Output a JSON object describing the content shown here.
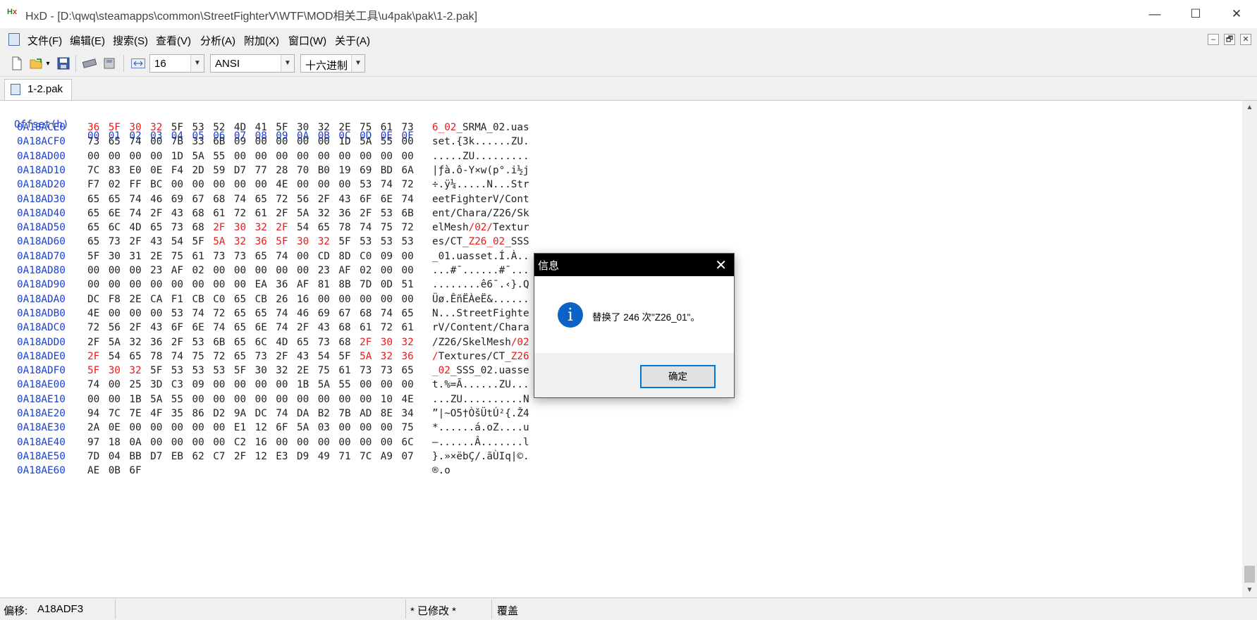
{
  "window": {
    "title": "HxD - [D:\\qwq\\steamapps\\common\\StreetFighterV\\WTF\\MOD相关工具\\u4pak\\pak\\1-2.pak]",
    "app_icon": "HxD",
    "minimize": "—",
    "maximize": "☐",
    "close": "✕"
  },
  "menu": {
    "items": [
      "文件(F)",
      "编辑(E)",
      "搜索(S)",
      "查看(V)",
      "分析(A)",
      "附加(X)",
      "窗口(W)",
      "关于(A)"
    ],
    "mdi": [
      "–",
      "🗗",
      "✕"
    ]
  },
  "toolbar": {
    "icons": [
      "new-file-icon",
      "open-file-icon",
      "save-icon",
      "ram-icon",
      "disk-icon",
      "columns-icon"
    ],
    "bytes_per_row": "16",
    "charset": "ANSI",
    "offset_base": "十六进制"
  },
  "tab": {
    "label": "1-2.pak"
  },
  "hex": {
    "header_offset": "Offset(h)",
    "header_cols": [
      "00",
      "01",
      "02",
      "03",
      "04",
      "05",
      "06",
      "07",
      "08",
      "09",
      "0A",
      "0B",
      "0C",
      "0D",
      "0E",
      "0F"
    ],
    "rows": [
      {
        "o": "0A18ACE0",
        "b": "36 5F 30 32 5F 53 52 4D 41 5F 30 32 2E 75 61 73",
        "a": "6_02_SRMA_02.uas",
        "hl": [
          0,
          1,
          2,
          3
        ]
      },
      {
        "o": "0A18ACF0",
        "b": "73 65 74 00 7B 33 6B 09 00 00 00 00 1D 5A 55 00",
        "a": "set.{3k......ZU.",
        "hl": []
      },
      {
        "o": "0A18AD00",
        "b": "00 00 00 00 1D 5A 55 00 00 00 00 00 00 00 00 00",
        "a": ".....ZU.........",
        "hl": []
      },
      {
        "o": "0A18AD10",
        "b": "7C 83 E0 0E F4 2D 59 D7 77 28 70 B0 19 69 BD 6A",
        "a": "|ƒà.ô-Y×w(p°.i½j",
        "hl": []
      },
      {
        "o": "0A18AD20",
        "b": "F7 02 FF BC 00 00 00 00 00 4E 00 00 00 53 74 72",
        "a": "÷.ÿ¼.....N...Str",
        "hl": []
      },
      {
        "o": "0A18AD30",
        "b": "65 65 74 46 69 67 68 74 65 72 56 2F 43 6F 6E 74",
        "a": "eetFighterV/Cont",
        "hl": []
      },
      {
        "o": "0A18AD40",
        "b": "65 6E 74 2F 43 68 61 72 61 2F 5A 32 36 2F 53 6B",
        "a": "ent/Chara/Z26/Sk",
        "hl": []
      },
      {
        "o": "0A18AD50",
        "b": "65 6C 4D 65 73 68 2F 30 32 2F 54 65 78 74 75 72",
        "a": "elMesh/02/Textur",
        "hl": [
          6,
          7,
          8,
          9
        ]
      },
      {
        "o": "0A18AD60",
        "b": "65 73 2F 43 54 5F 5A 32 36 5F 30 32 5F 53 53 53",
        "a": "es/CT_Z26_02_SSS",
        "hl": [
          6,
          7,
          8,
          9,
          10,
          11
        ]
      },
      {
        "o": "0A18AD70",
        "b": "5F 30 31 2E 75 61 73 73 65 74 00 CD 8D C0 09 00",
        "a": "_01.uasset.Í.À..",
        "hl": []
      },
      {
        "o": "0A18AD80",
        "b": "00 00 00 23 AF 02 00 00 00 00 00 23 AF 02 00 00",
        "a": "...#¯......#¯...",
        "hl": []
      },
      {
        "o": "0A18AD90",
        "b": "00 00 00 00 00 00 00 00 EA 36 AF 81 8B 7D 0D 51",
        "a": "........ê6¯.‹}.Q",
        "hl": []
      },
      {
        "o": "0A18ADA0",
        "b": "DC F8 2E CA F1 CB C0 65 CB 26 16 00 00 00 00 00",
        "a": "Üø.ÊñËÀeË&......",
        "hl": []
      },
      {
        "o": "0A18ADB0",
        "b": "4E 00 00 00 53 74 72 65 65 74 46 69 67 68 74 65",
        "a": "N...StreetFighte",
        "hl": []
      },
      {
        "o": "0A18ADC0",
        "b": "72 56 2F 43 6F 6E 74 65 6E 74 2F 43 68 61 72 61",
        "a": "rV/Content/Chara",
        "hl": []
      },
      {
        "o": "0A18ADD0",
        "b": "2F 5A 32 36 2F 53 6B 65 6C 4D 65 73 68 2F 30 32",
        "a": "/Z26/SkelMesh/02",
        "hl": [
          13,
          14,
          15
        ]
      },
      {
        "o": "0A18ADE0",
        "b": "2F 54 65 78 74 75 72 65 73 2F 43 54 5F 5A 32 36",
        "a": "/Textures/CT_Z26",
        "hl": [
          0,
          13,
          14,
          15
        ]
      },
      {
        "o": "0A18ADF0",
        "b": "5F 30 32 5F 53 53 53 5F 30 32 2E 75 61 73 73 65",
        "a": "_02_SSS_02.uasse",
        "hl": [
          0,
          1,
          2
        ]
      },
      {
        "o": "0A18AE00",
        "b": "74 00 25 3D C3 09 00 00 00 00 1B 5A 55 00 00 00",
        "a": "t.%=Ã......ZU...",
        "hl": []
      },
      {
        "o": "0A18AE10",
        "b": "00 00 1B 5A 55 00 00 00 00 00 00 00 00 00 10 4E",
        "a": "...ZU..........N",
        "hl": []
      },
      {
        "o": "0A18AE20",
        "b": "94 7C 7E 4F 35 86 D2 9A DC 74 DA B2 7B AD 8E 34",
        "a": "”|~O5†ÒšÜtÚ²{.Ž4",
        "hl": []
      },
      {
        "o": "0A18AE30",
        "b": "2A 0E 00 00 00 00 00 E1 12 6F 5A 03 00 00 00 75",
        "a": "*......á.oZ....u",
        "hl": []
      },
      {
        "o": "0A18AE40",
        "b": "97 18 0A 00 00 00 00 C2 16 00 00 00 00 00 00 6C",
        "a": "—......Â.......l",
        "hl": []
      },
      {
        "o": "0A18AE50",
        "b": "7D 04 BB D7 EB 62 C7 2F 12 E3 D9 49 71 7C A9 07",
        "a": "}.»×ëbÇ/.ãÙIq|©.",
        "hl": []
      },
      {
        "o": "0A18AE60",
        "b": "AE 0B 6F",
        "a": "®.o",
        "hl": []
      }
    ]
  },
  "dialog": {
    "title": "信息",
    "message": "替换了 246 次\"Z26_01\"。",
    "ok": "确定",
    "icon_letter": "i",
    "close": "✕"
  },
  "status": {
    "offset_label": "偏移:",
    "offset_value": "A18ADF3",
    "modified": "* 已修改 *",
    "mode": "覆盖"
  },
  "scroll": {
    "up": "▲",
    "down": "▼"
  }
}
